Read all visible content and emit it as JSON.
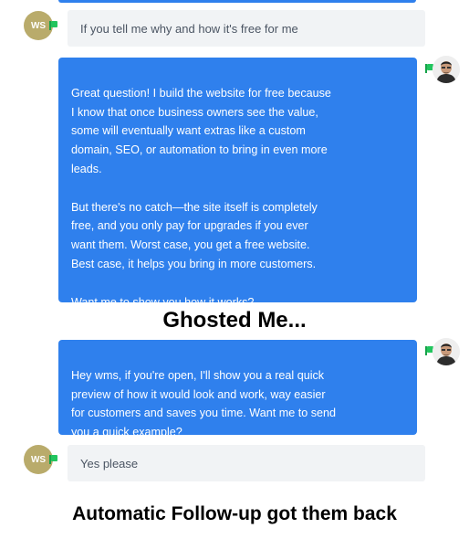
{
  "messages": [
    {
      "sender": "contact",
      "avatar_initials": "WS",
      "text": "If you tell me why and how it's free for me"
    },
    {
      "sender": "agent",
      "text": "Great question! I build the website for free because\nI know that once business owners see the value,\nsome will eventually want extras like a custom\ndomain, SEO, or automation to bring in even more\nleads.\n\nBut there's no catch—the site itself is completely\nfree, and you only pay for upgrades if you ever\nwant them. Worst case, you get a free website.\nBest case, it helps you bring in more customers.\n\nWant me to show you how it works?"
    },
    {
      "sender": "agent",
      "text": "Hey wms, if you're open, I'll show you a real quick\npreview of how it would look and work, way easier\nfor customers and saves you time. Want me to send\nyou a quick example?"
    },
    {
      "sender": "contact",
      "avatar_initials": "WS",
      "text": "Yes please"
    }
  ],
  "captions": {
    "ghosted": "Ghosted Me...",
    "followup": "Automatic Follow-up got them back"
  },
  "colors": {
    "agent_bubble": "#2f80ed",
    "contact_bubble": "#f1f3f5",
    "contact_avatar": "#b9ab6b",
    "status_flag": "#22c55e"
  }
}
